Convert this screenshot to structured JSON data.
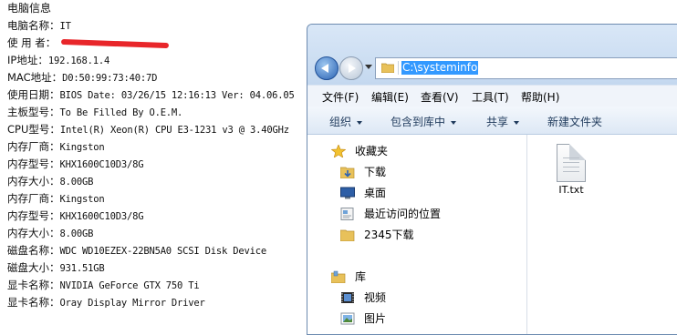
{
  "info": {
    "title": "电脑信息",
    "rows": [
      {
        "k": "电脑名称：",
        "v": "IT"
      },
      {
        "k": "使 用 者：",
        "v": ""
      },
      {
        "k": "IP地址：",
        "v": "192.168.1.4"
      },
      {
        "k": "MAC地址：",
        "v": "D0:50:99:73:40:7D"
      },
      {
        "k": "使用日期：",
        "v": "BIOS Date: 03/26/15 12:16:13 Ver: 04.06.05"
      },
      {
        "k": "主板型号：",
        "v": "To Be Filled By O.E.M."
      },
      {
        "k": "CPU型号：",
        "v": "Intel(R) Xeon(R) CPU E3-1231 v3 @ 3.40GHz"
      },
      {
        "k": "内存厂商：",
        "v": "Kingston"
      },
      {
        "k": "内存型号：",
        "v": "KHX1600C10D3/8G"
      },
      {
        "k": "内存大小：",
        "v": "8.00GB"
      },
      {
        "k": "内存厂商：",
        "v": "Kingston"
      },
      {
        "k": "内存型号：",
        "v": "KHX1600C10D3/8G"
      },
      {
        "k": "内存大小：",
        "v": "8.00GB"
      },
      {
        "k": "磁盘名称：",
        "v": "WDC WD10EZEX-22BN5A0 SCSI Disk Device"
      },
      {
        "k": "磁盘大小：",
        "v": "931.51GB"
      },
      {
        "k": "显卡名称：",
        "v": "NVIDIA GeForce GTX 750 Ti"
      },
      {
        "k": "显卡名称：",
        "v": "Oray Display Mirror Driver"
      }
    ]
  },
  "explorer": {
    "address": "C:\\systeminfo",
    "menu": [
      "文件(F)",
      "编辑(E)",
      "查看(V)",
      "工具(T)",
      "帮助(H)"
    ],
    "toolbar": [
      "组织",
      "包含到库中",
      "共享",
      "新建文件夹"
    ],
    "nav": {
      "favorites_label": "收藏夹",
      "favorites": [
        "下载",
        "桌面",
        "最近访问的位置",
        "2345下载"
      ],
      "library_label": "库",
      "library": [
        "视频",
        "图片"
      ]
    },
    "files": [
      {
        "name": "IT.txt",
        "icon": "text-file-icon"
      }
    ]
  }
}
